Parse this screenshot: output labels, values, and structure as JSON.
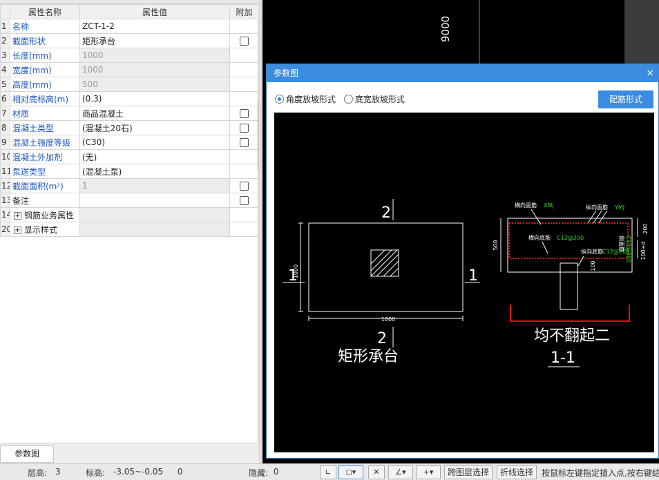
{
  "table": {
    "headers": [
      "",
      "属性名称",
      "属性值",
      "附加"
    ],
    "rows": [
      {
        "num": "1",
        "name": "名称",
        "value": "ZCT-1-2",
        "style": "blue",
        "checkbox": false,
        "valstyle": ""
      },
      {
        "num": "2",
        "name": "截面形状",
        "value": "矩形承台",
        "style": "blue",
        "checkbox": true,
        "valstyle": ""
      },
      {
        "num": "3",
        "name": "长度(mm)",
        "value": "1000",
        "style": "blue",
        "checkbox": false,
        "valstyle": "gray"
      },
      {
        "num": "4",
        "name": "宽度(mm)",
        "value": "1000",
        "style": "blue",
        "checkbox": false,
        "valstyle": "gray"
      },
      {
        "num": "5",
        "name": "高度(mm)",
        "value": "500",
        "style": "blue",
        "checkbox": false,
        "valstyle": "gray"
      },
      {
        "num": "6",
        "name": "相对底标高(m)",
        "value": "(0.3)",
        "style": "blue",
        "checkbox": false,
        "valstyle": ""
      },
      {
        "num": "7",
        "name": "材质",
        "value": "商品混凝土",
        "style": "blue",
        "checkbox": true,
        "valstyle": ""
      },
      {
        "num": "8",
        "name": "混凝土类型",
        "value": "(混凝土20石)",
        "style": "blue",
        "checkbox": true,
        "valstyle": ""
      },
      {
        "num": "9",
        "name": "混凝土强度等级",
        "value": "(C30)",
        "style": "blue",
        "checkbox": true,
        "valstyle": ""
      },
      {
        "num": "10",
        "name": "混凝土外加剂",
        "value": "(无)",
        "style": "blue",
        "checkbox": false,
        "valstyle": ""
      },
      {
        "num": "11",
        "name": "泵送类型",
        "value": "(混凝土泵)",
        "style": "blue",
        "checkbox": false,
        "valstyle": ""
      },
      {
        "num": "12",
        "name": "截面面积(m²)",
        "value": "1",
        "style": "blue",
        "checkbox": true,
        "valstyle": "gray"
      },
      {
        "num": "13",
        "name": "备注",
        "value": "",
        "style": "black",
        "checkbox": true,
        "valstyle": ""
      },
      {
        "num": "14",
        "name": "钢筋业务属性",
        "value": "",
        "style": "black",
        "checkbox": false,
        "valstyle": "dark",
        "expandable": true
      },
      {
        "num": "20",
        "name": "显示样式",
        "value": "",
        "style": "black",
        "checkbox": false,
        "valstyle": "dark",
        "expandable": true
      }
    ]
  },
  "bottom_tab": "参数图",
  "canvas": {
    "dimension_text": "9000"
  },
  "dialog": {
    "title": "参数图",
    "close": "×",
    "radio1": "角度放坡形式",
    "radio2": "底宽放坡形式",
    "button": "配筋形式"
  },
  "drawing": {
    "plan_label": "矩形承台",
    "section_label": "1-1",
    "note": "均不翻起二",
    "mark_1_left": "1",
    "mark_1_right": "1",
    "mark_2_top": "2",
    "mark_2_bottom": "2",
    "dim_width": "1000",
    "dim_height": "1000",
    "dim_section_h": "500",
    "dim_200": "200",
    "dim_100d": "100+d",
    "dim_100": "100",
    "lbl_heng_mian": "横向面筋",
    "lbl_zong_mian": "纵向面筋",
    "lbl_heng_di": "横向底筋",
    "lbl_zong_di": "纵向底筋",
    "lbl_ce_mian": "侧面筋",
    "lbl_xmj": "XMJ",
    "lbl_ymj": "YMJ",
    "lbl_c12_1": "C12@200",
    "lbl_c12_2": "C12@200",
    "lbl_c12_v": "C12@200"
  },
  "status": {
    "floor_label": "层高:",
    "floor_value": "3",
    "elev_label": "标高:",
    "elev_value": "-3.05~-0.05",
    "count": "0",
    "hidden_label": "隐藏:",
    "hidden_value": "0",
    "btn_cross": "跨图层选择",
    "btn_poly": "折线选择",
    "hint": "按鼠标左键指定插入点,按右键结"
  },
  "colors": {
    "accent": "#3b8be0",
    "label_blue": "#1a56c8",
    "rebar_red": "#e01010",
    "cad_green": "#20e020"
  }
}
